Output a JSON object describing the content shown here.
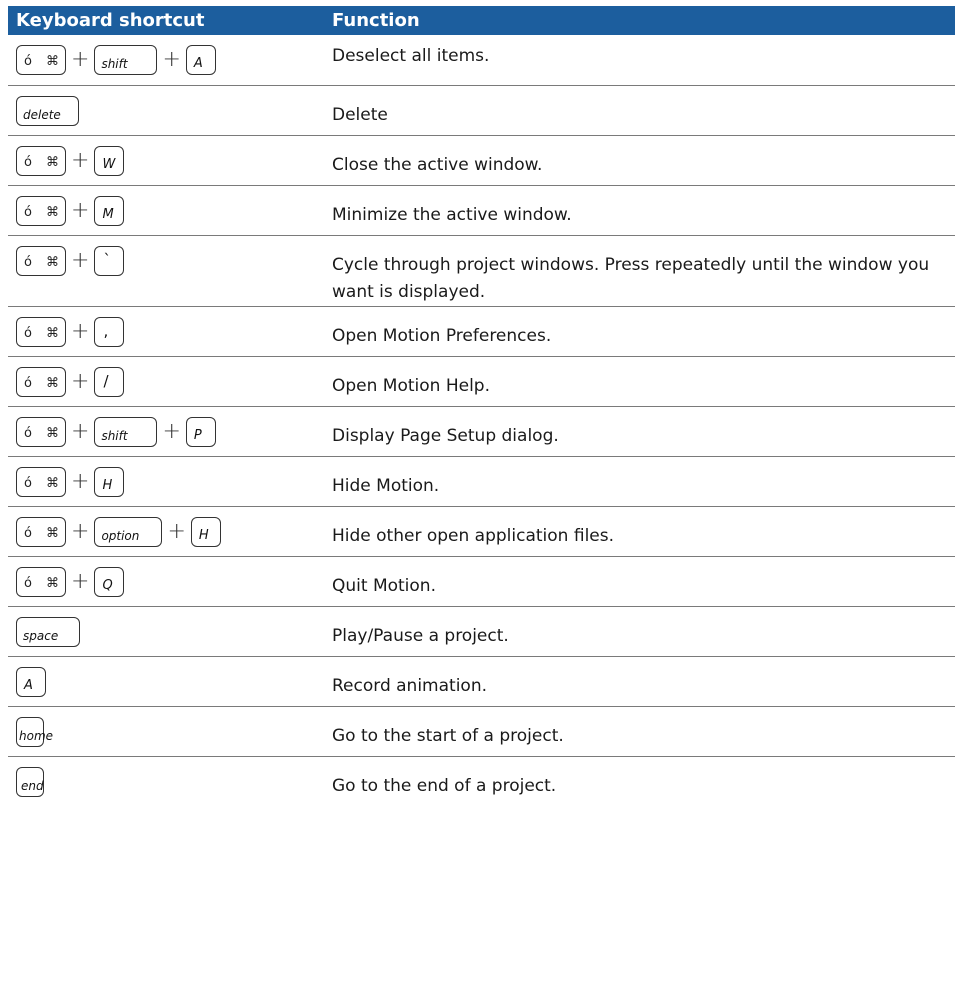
{
  "header": {
    "col1": "Keyboard shortcut",
    "col2": "Function"
  },
  "glyphs": {
    "apple": "ó",
    "command": "⌘",
    "plus": "+"
  },
  "keys": {
    "shift": "shift",
    "delete": "delete",
    "option": "option",
    "space": "space",
    "home": "home",
    "end": "end",
    "A": "A",
    "W": "W",
    "M": "M",
    "P": "P",
    "H": "H",
    "Q": "Q",
    "grave": "`",
    "comma": ",",
    "slash": "/"
  },
  "rows": [
    {
      "function": "Deselect all items."
    },
    {
      "function": "Delete"
    },
    {
      "function": "Close the active window."
    },
    {
      "function": "Minimize the active window."
    },
    {
      "function": "Cycle through project windows. Press repeatedly until the window you want is displayed."
    },
    {
      "function": "Open Motion Preferences."
    },
    {
      "function": "Open Motion Help."
    },
    {
      "function": "Display Page Setup dialog."
    },
    {
      "function": "Hide Motion."
    },
    {
      "function": "Hide other open application files."
    },
    {
      "function": "Quit Motion."
    },
    {
      "function": "Play/Pause a project."
    },
    {
      "function": "Record animation."
    },
    {
      "function": "Go to the start of a project."
    },
    {
      "function": "Go to the end of a project."
    }
  ]
}
